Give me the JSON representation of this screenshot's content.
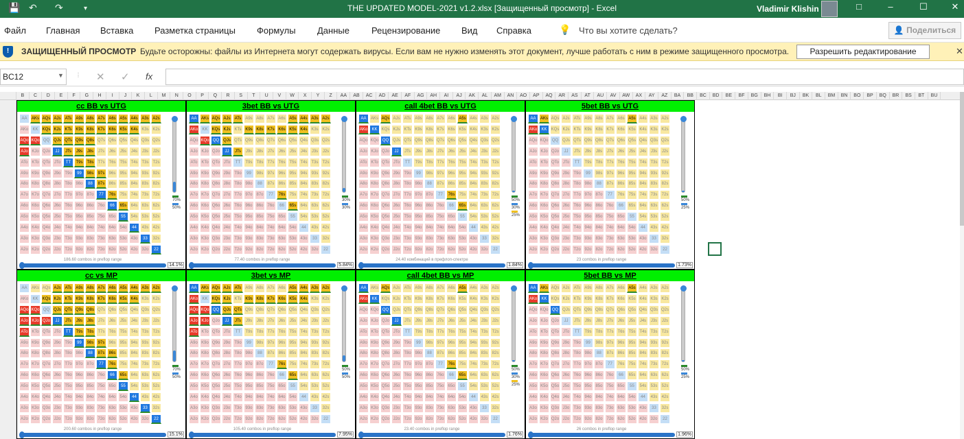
{
  "app": {
    "window_title": "THE UPDATED MODEL-2021 v1.2.xlsx  [Защищенный просмотр]  -  Excel",
    "user_name": "Vladimir Klishin",
    "qat_icons": [
      "save-icon",
      "undo-icon",
      "redo-icon",
      "customize-icon"
    ],
    "window_controls": [
      "ribbon-display-icon",
      "minimize-icon",
      "maximize-icon",
      "close-icon"
    ]
  },
  "menu": {
    "items": [
      "Файл",
      "Главная",
      "Вставка",
      "Разметка страницы",
      "Формулы",
      "Данные",
      "Рецензирование",
      "Вид",
      "Справка"
    ],
    "tell_me": "Что вы хотите сделать?",
    "share": "Поделиться"
  },
  "protected_view": {
    "title": "ЗАЩИЩЕННЫЙ ПРОСМОТР",
    "message": "Будьте осторожны: файлы из Интернета могут содержать вирусы. Если вам не нужно изменять этот документ, лучше работать с ним в режиме защищенного просмотра.",
    "button": "Разрешить редактирование"
  },
  "formula_bar": {
    "name_box": "BC12",
    "fx": "fx",
    "value": ""
  },
  "columns": [
    "B",
    "C",
    "D",
    "E",
    "F",
    "G",
    "H",
    "I",
    "J",
    "K",
    "L",
    "M",
    "N",
    "O",
    "P",
    "Q",
    "R",
    "S",
    "T",
    "U",
    "V",
    "W",
    "X",
    "Y",
    "Z",
    "AA",
    "AB",
    "AC",
    "AD",
    "AE",
    "AF",
    "AG",
    "AH",
    "AI",
    "AJ",
    "AK",
    "AL",
    "AM",
    "AN",
    "AO",
    "AP",
    "AQ",
    "AR",
    "AS",
    "AT",
    "AU",
    "AV",
    "AW",
    "AX",
    "AY",
    "AZ",
    "BA",
    "BB",
    "BC",
    "BD",
    "BE",
    "BF",
    "BG",
    "BH",
    "BI",
    "BJ",
    "BK",
    "BL",
    "BM",
    "BN",
    "BO",
    "BP",
    "BQ",
    "BR",
    "BS",
    "BT",
    "BU"
  ],
  "ranks": [
    "A",
    "K",
    "Q",
    "J",
    "T",
    "9",
    "8",
    "7",
    "6",
    "5",
    "4",
    "3",
    "2"
  ],
  "panels": [
    {
      "title": "cc BB vs UTG",
      "combos": "186.60 combos in preflop range",
      "pct": "14.1%",
      "legend": [
        "70%",
        "50%"
      ],
      "fill": 0.14,
      "highlight": [
        "AKs",
        "AQs",
        "AJs",
        "ATs",
        "A9s",
        "A8s",
        "A7s",
        "A6s",
        "A5s",
        "A4s",
        "A3s",
        "A2s",
        "KQs",
        "KJs",
        "KTs",
        "K9s",
        "K8s",
        "K7s",
        "K6s",
        "K5s",
        "K4s",
        "QJs",
        "QTs",
        "Q9s",
        "Q8s",
        "JTs",
        "J9s",
        "J8s",
        "T9s",
        "T8s",
        "98s",
        "97s",
        "87s",
        "76s",
        "65s",
        "AQo",
        "KQo",
        "AJo",
        "JJ",
        "TT",
        "99",
        "88",
        "77",
        "66",
        "55",
        "44",
        "33",
        "22"
      ]
    },
    {
      "title": "3bet BB vs UTG",
      "combos": "77.40 combos in preflop range",
      "pct": "5.84%",
      "legend": [
        "30%",
        "30%"
      ],
      "fill": 0.06,
      "highlight": [
        "AKs",
        "AQs",
        "AJs",
        "ATs",
        "A5s",
        "A4s",
        "A3s",
        "A2s",
        "KQs",
        "KJs",
        "K9s",
        "K8s",
        "K7s",
        "K6s",
        "K5s",
        "K4s",
        "QJs",
        "JTs",
        "76s",
        "65s",
        "AA",
        "AKo",
        "KQo",
        "QQ",
        "JJ"
      ]
    },
    {
      "title": "call 4bet BB vs UTG",
      "combos": "24.40 комбинаций в префлоп-спектре",
      "pct": "1.84%",
      "legend": [
        "50%",
        "30%",
        "25%"
      ],
      "fill": 0.02,
      "highlight": [
        "AQs",
        "A5s",
        "AA",
        "AKo",
        "KK",
        "QQ",
        "JJ",
        "76s",
        "65s"
      ]
    },
    {
      "title": "5bet BB vs UTG",
      "combos": "23 combos in preflop range",
      "pct": "1.73%",
      "legend": [
        "50%",
        "25%"
      ],
      "fill": 0.02,
      "highlight": [
        "AKs",
        "A5s",
        "AA",
        "AKo",
        "KK"
      ]
    },
    {
      "title": "cc vs MP",
      "combos": "200.60 combos in preflop range",
      "pct": "15.1%",
      "legend": [
        "70%",
        "50%"
      ],
      "fill": 0.15,
      "highlight": [
        "AJs",
        "ATs",
        "A9s",
        "A8s",
        "A7s",
        "A6s",
        "A5s",
        "A4s",
        "A3s",
        "A2s",
        "KQs",
        "KJs",
        "KTs",
        "K9s",
        "K8s",
        "K7s",
        "K6s",
        "K5s",
        "K4s",
        "QJs",
        "QTs",
        "Q9s",
        "Q8s",
        "JTs",
        "J9s",
        "J8s",
        "T9s",
        "T8s",
        "98s",
        "97s",
        "87s",
        "86s",
        "76s",
        "65s",
        "AQo",
        "KQo",
        "AJo",
        "KJo",
        "QJo",
        "ATo",
        "JJ",
        "TT",
        "99",
        "88",
        "77",
        "66",
        "55",
        "44",
        "33",
        "22"
      ]
    },
    {
      "title": "3bet vs MP",
      "combos": "105.40 combos in preflop range",
      "pct": "7.95%",
      "legend": [
        "50%",
        "50%"
      ],
      "fill": 0.08,
      "highlight": [
        "AKs",
        "AQs",
        "AJs",
        "ATs",
        "A5s",
        "A4s",
        "A3s",
        "A2s",
        "KQs",
        "KJs",
        "K9s",
        "K8s",
        "K7s",
        "K6s",
        "K5s",
        "K4s",
        "QJs",
        "QTs",
        "JTs",
        "76s",
        "65s",
        "AA",
        "AKo",
        "KQo",
        "AQo",
        "QQ",
        "AJo",
        "KJo",
        "JJ",
        "ATo"
      ]
    },
    {
      "title": "call 4bet BB vs MP",
      "combos": "23.40 combos in preflop range",
      "pct": "1.76%",
      "legend": [
        "50%",
        "30%",
        "25%"
      ],
      "fill": 0.02,
      "highlight": [
        "AQs",
        "A5s",
        "AA",
        "AKo",
        "KK",
        "QQ",
        "JJ",
        "76s",
        "65s"
      ]
    },
    {
      "title": "5bet BB vs MP",
      "combos": "26 combos in preflop range",
      "pct": "1.96%",
      "legend": [
        "50%",
        "25%"
      ],
      "fill": 0.02,
      "highlight": [
        "AKs",
        "A5s",
        "AA",
        "AKo",
        "KK",
        "QQ"
      ]
    }
  ]
}
